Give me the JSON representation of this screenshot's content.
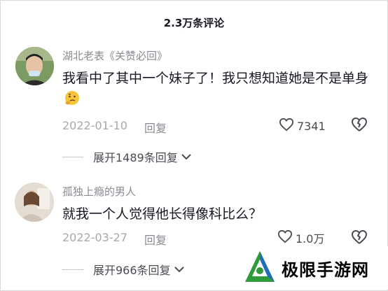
{
  "header": {
    "title": "2.3万条评论"
  },
  "comments": [
    {
      "username": "湖北老表《关赞必回》",
      "text": "我看中了其中一个妹子了！我只想知道她是不是单身",
      "emoji": "thinking-face-icon",
      "date": "2022-01-10",
      "reply_label": "回复",
      "likes": "7341",
      "expand_label": "展开1489条回复"
    },
    {
      "username": "孤独上瘾的男人",
      "text": "就我一个人觉得他长得像科比么？",
      "date": "2022-03-27",
      "reply_label": "回复",
      "likes": "1.0万",
      "expand_label": "展开966条回复"
    }
  ],
  "watermark": {
    "text": "极限手游网"
  },
  "colors": {
    "text": "#161823",
    "secondary": "#8a8b91",
    "date": "#a8a9ae",
    "watermark_green": "#2e9a3a"
  }
}
